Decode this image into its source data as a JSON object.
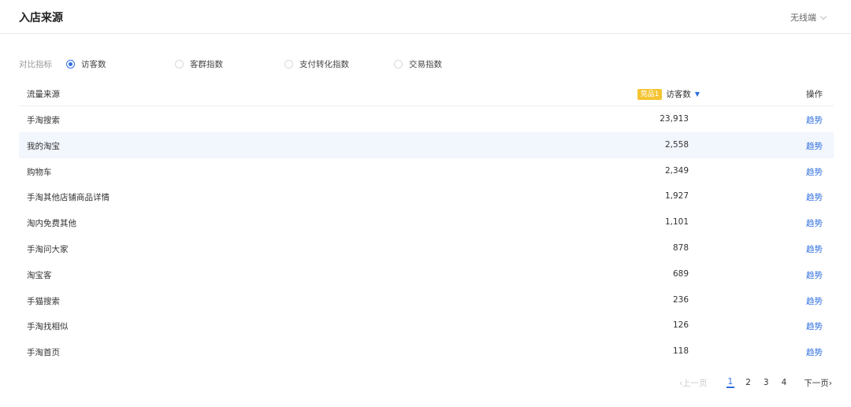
{
  "header": {
    "title": "入店来源",
    "client_select": "无线端"
  },
  "metrics": {
    "label": "对比指标",
    "options": [
      "访客数",
      "客群指数",
      "支付转化指数",
      "交易指数"
    ],
    "selected": "访客数"
  },
  "table": {
    "columns": {
      "source": "流量来源",
      "badge": "竞品1",
      "visitors": "访客数",
      "ops": "操作"
    },
    "rows": [
      {
        "source": "手淘搜索",
        "value": "23,913",
        "trend": "趋势"
      },
      {
        "source": "我的淘宝",
        "value": "2,558",
        "trend": "趋势"
      },
      {
        "source": "购物车",
        "value": "2,349",
        "trend": "趋势"
      },
      {
        "source": "手淘其他店铺商品详情",
        "value": "1,927",
        "trend": "趋势"
      },
      {
        "source": "淘内免费其他",
        "value": "1,101",
        "trend": "趋势"
      },
      {
        "source": "手淘问大家",
        "value": "878",
        "trend": "趋势"
      },
      {
        "source": "淘宝客",
        "value": "689",
        "trend": "趋势"
      },
      {
        "source": "手猫搜索",
        "value": "236",
        "trend": "趋势"
      },
      {
        "source": "手淘找相似",
        "value": "126",
        "trend": "趋势"
      },
      {
        "source": "手淘首页",
        "value": "118",
        "trend": "趋势"
      }
    ]
  },
  "pagination": {
    "prev": "上一页",
    "pages": [
      "1",
      "2",
      "3",
      "4"
    ],
    "current": "1",
    "next": "下一页"
  },
  "colors": {
    "accent": "#2f6fe0",
    "badge": "#f4c433",
    "row_highlight": "#f2f6fd"
  }
}
